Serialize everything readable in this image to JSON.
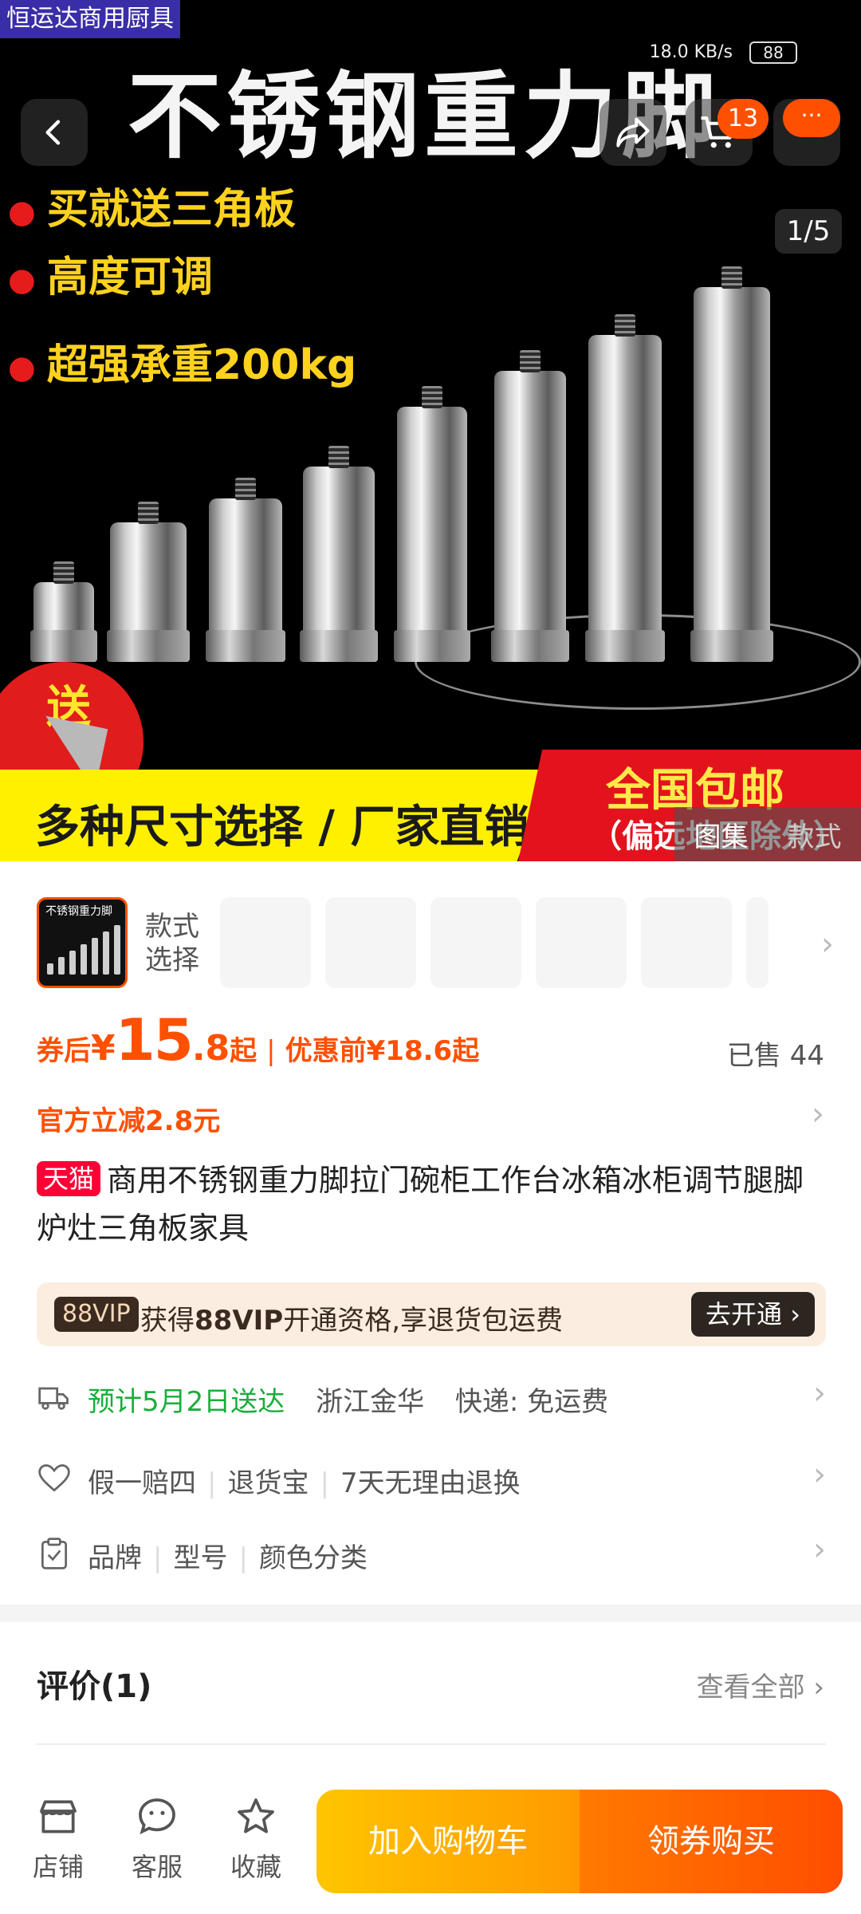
{
  "hero": {
    "watermark": "恒运达商用厨具",
    "title": "不锈钢重力脚",
    "bullets": [
      "买就送三角板",
      "高度可调",
      "超强承重200kg"
    ],
    "gift": "送",
    "banner_left": "多种尺寸选择 / 厂家直销",
    "banner_right_line1": "全国包邮",
    "banner_right_line2": "（偏远地区除外）",
    "page_counter": "1/5",
    "gallery_tabs": [
      "图集",
      "款式"
    ]
  },
  "status_bar": {
    "network": "18.0 KB/s",
    "battery": "88"
  },
  "nav": {
    "cart_count": "13",
    "more_label": "···"
  },
  "sku": {
    "thumb_text": "不锈钢重力脚",
    "label_line1": "款式",
    "label_line2": "选择"
  },
  "price": {
    "after_coupon_label": "券后",
    "currency": "¥",
    "integer": "15",
    "decimal": ".8",
    "suffix": "起",
    "separator": "|",
    "before_label": "优惠前",
    "before_value": "¥18.6",
    "before_suffix": "起",
    "sold": "已售 44"
  },
  "discount": "官方立减2.8元",
  "product": {
    "badge": "天猫",
    "title": "商用不锈钢重力脚拉门碗柜工作台冰箱冰柜调节腿脚炉灶三角板家具"
  },
  "vip": {
    "tag": "88VIP",
    "text_pre": "获得",
    "text_bold": "88VIP",
    "text_post": "开通资格,享退货包运费",
    "button": "去开通"
  },
  "delivery": {
    "estimate": "预计5月2日送达",
    "origin": "浙江金华",
    "shipping": "快递: 免运费"
  },
  "service": {
    "items": [
      "假一赔四",
      "退货宝",
      "7天无理由退换"
    ]
  },
  "params": {
    "items": [
      "品牌",
      "型号",
      "颜色分类"
    ]
  },
  "reviews": {
    "title": "评价(1)",
    "see_all": "查看全部"
  },
  "bottom_bar": {
    "shop": "店铺",
    "service": "客服",
    "favorite": "收藏",
    "add_cart": "加入购物车",
    "buy": "领券购买"
  },
  "colors": {
    "accent": "#ff5000",
    "tmall": "#ff0036",
    "green": "#1aad3b",
    "cart_btn": "#ffb300",
    "buy_btn": "#ff5a00"
  }
}
